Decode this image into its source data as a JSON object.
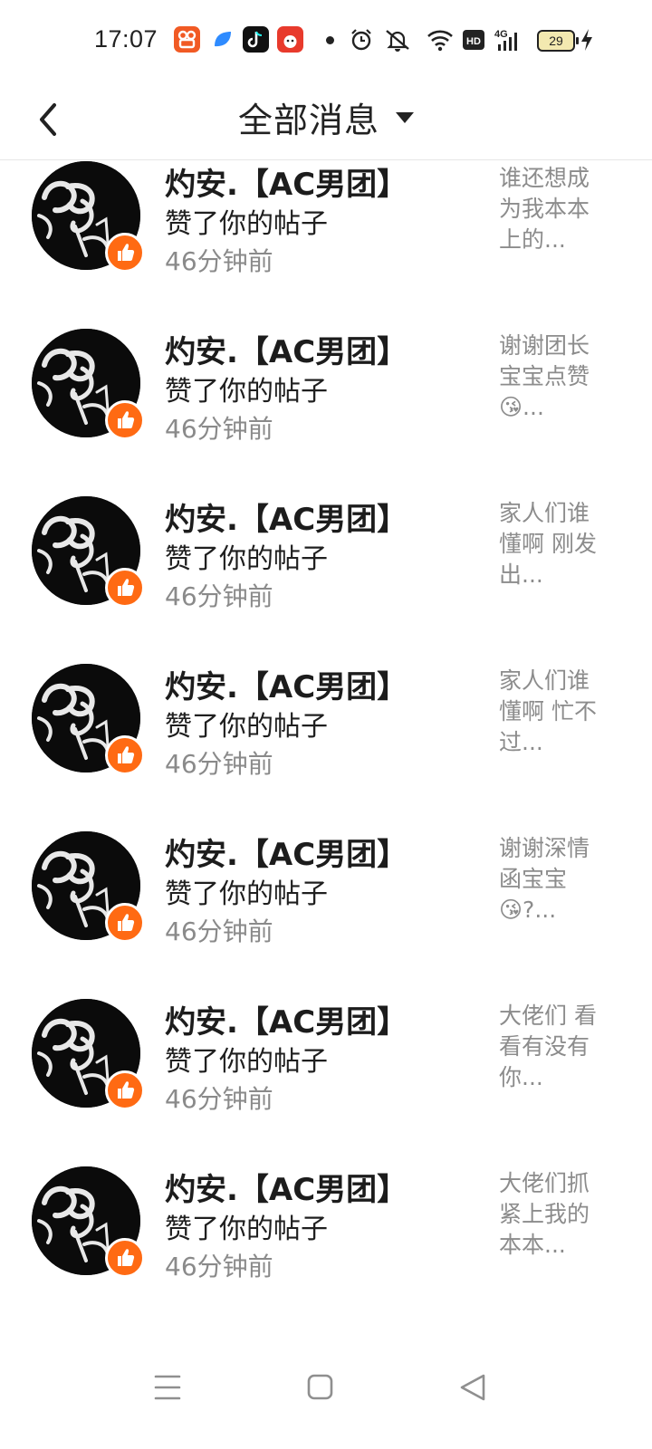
{
  "status_bar": {
    "time": "17:07",
    "apps": [
      {
        "icon": "kuaishou-app-icon",
        "color": "#f15a24"
      },
      {
        "icon": "blue-leaf-app-icon",
        "color": "#2e8bff"
      },
      {
        "icon": "tiktok-app-icon",
        "color": "#111111"
      },
      {
        "icon": "taobao-38-app-icon",
        "color": "#e83a2c"
      }
    ],
    "icons": [
      "notification-dot-icon",
      "alarm-icon",
      "mute-icon",
      "wifi-icon",
      "hd-icon",
      "signal-4g-icon",
      "charging-icon"
    ],
    "signal_label": "4G",
    "battery": "29"
  },
  "header": {
    "back_icon": "chevron-left-icon",
    "title": "全部消息",
    "dropdown_icon": "caret-down-icon"
  },
  "notifications": [
    {
      "name": "灼安.【AC男团】",
      "action": "赞了你的帖子",
      "time": "46分钟前",
      "preview": "谁还想成\n为我本本\n上的..."
    },
    {
      "name": "灼安.【AC男团】",
      "action": "赞了你的帖子",
      "time": "46分钟前",
      "preview": "谢谢团长\n宝宝点赞\n😘..."
    },
    {
      "name": "灼安.【AC男团】",
      "action": "赞了你的帖子",
      "time": "46分钟前",
      "preview": "家人们谁\n懂啊 刚发\n出..."
    },
    {
      "name": "灼安.【AC男团】",
      "action": "赞了你的帖子",
      "time": "46分钟前",
      "preview": "家人们谁\n懂啊 忙不\n过..."
    },
    {
      "name": "灼安.【AC男团】",
      "action": "赞了你的帖子",
      "time": "46分钟前",
      "preview": "谢谢深情\n函宝宝\n😘?..."
    },
    {
      "name": "灼安.【AC男团】",
      "action": "赞了你的帖子",
      "time": "46分钟前",
      "preview": "大佬们 看\n看有没有\n你..."
    },
    {
      "name": "灼安.【AC男团】",
      "action": "赞了你的帖子",
      "time": "46分钟前",
      "preview": "大佬们抓\n紧上我的\n本本..."
    }
  ],
  "nav_bar": {
    "buttons": [
      "menu-icon",
      "home-square-icon",
      "back-triangle-icon"
    ]
  },
  "colors": {
    "accent": "#ff6a13",
    "text_primary": "#1c1c1c",
    "text_secondary": "#8a8a8a"
  }
}
